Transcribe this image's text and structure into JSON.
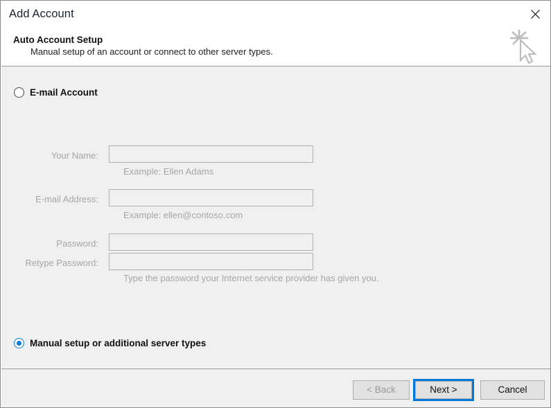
{
  "window": {
    "title": "Add Account",
    "close_icon": "close-icon"
  },
  "header": {
    "heading": "Auto Account Setup",
    "subheading": "Manual setup of an account or connect to other server types.",
    "icon": "cursor-sparkle-icon"
  },
  "options": [
    {
      "id": "email-account",
      "label": "E-mail Account",
      "selected": false
    },
    {
      "id": "manual-setup",
      "label": "Manual setup or additional server types",
      "selected": true
    }
  ],
  "form": {
    "enabled": false,
    "fields": [
      {
        "id": "your-name",
        "label": "Your Name:",
        "value": "",
        "placeholder": ""
      },
      {
        "id": "email-address",
        "label": "E-mail Address:",
        "value": "",
        "placeholder": ""
      },
      {
        "id": "password",
        "label": "Password:",
        "value": "",
        "placeholder": ""
      },
      {
        "id": "retype-password",
        "label": "Retype Password:",
        "value": "",
        "placeholder": ""
      }
    ],
    "hints": {
      "name_example": "Example: Ellen Adams",
      "email_example": "Example: ellen@contoso.com",
      "password_note": "Type the password your Internet service provider has given you."
    }
  },
  "footer": {
    "back_label": "< Back",
    "back_disabled": true,
    "next_label": "Next >",
    "next_focused": true,
    "cancel_label": "Cancel"
  },
  "colors": {
    "accent": "#0078d7",
    "radio_selected": "#0a7bd4",
    "body_bg": "#f0f0f0",
    "titlebar_bg": "#ffffff",
    "disabled_text": "#a6a6a6"
  }
}
